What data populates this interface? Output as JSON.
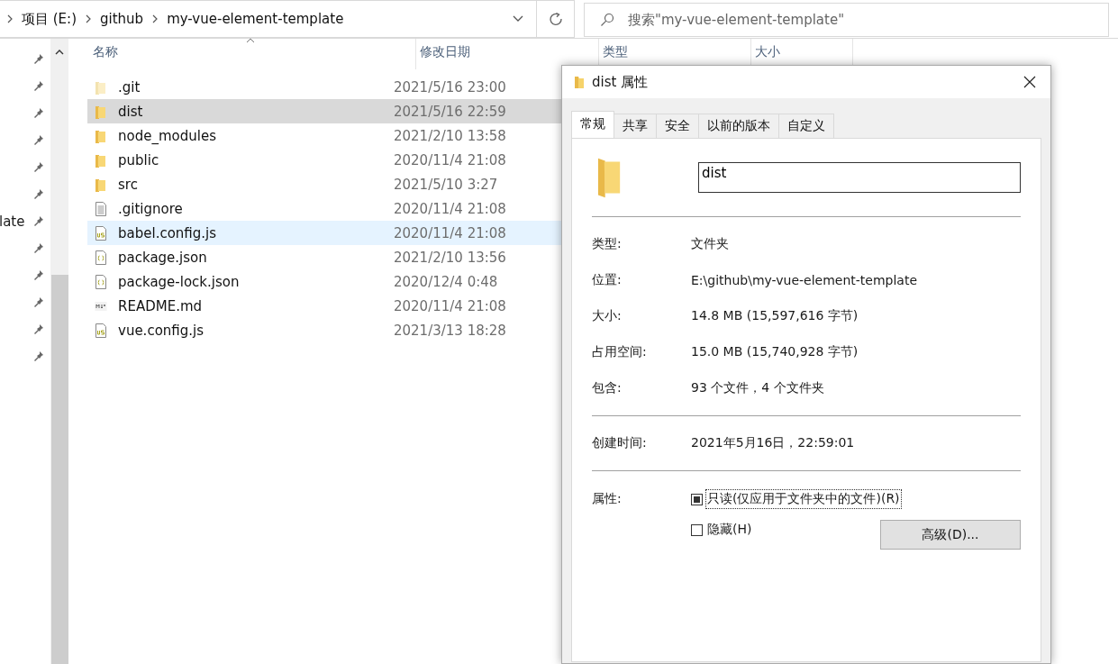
{
  "address_bar": {
    "breadcrumbs": [
      "项目 (E:)",
      "github",
      "my-vue-element-template"
    ]
  },
  "search": {
    "placeholder": "搜索\"my-vue-element-template\""
  },
  "nav_pane": {
    "visible_label": "late"
  },
  "file_list": {
    "columns": [
      "名称",
      "修改日期",
      "类型",
      "大小"
    ],
    "rows": [
      {
        "name": ".git",
        "date": "2021/5/16 23:00",
        "kind": "hidden-folder",
        "selected": false,
        "hovered": false
      },
      {
        "name": "dist",
        "date": "2021/5/16 22:59",
        "kind": "folder",
        "selected": true,
        "hovered": false
      },
      {
        "name": "node_modules",
        "date": "2021/2/10 13:58",
        "kind": "folder",
        "selected": false,
        "hovered": false
      },
      {
        "name": "public",
        "date": "2020/11/4 21:08",
        "kind": "folder",
        "selected": false,
        "hovered": false
      },
      {
        "name": "src",
        "date": "2021/5/10 3:27",
        "kind": "folder",
        "selected": false,
        "hovered": false
      },
      {
        "name": ".gitignore",
        "date": "2020/11/4 21:08",
        "kind": "text",
        "selected": false,
        "hovered": false
      },
      {
        "name": "babel.config.js",
        "date": "2020/11/4 21:08",
        "kind": "js",
        "selected": false,
        "hovered": true
      },
      {
        "name": "package.json",
        "date": "2021/2/10 13:56",
        "kind": "json",
        "selected": false,
        "hovered": false
      },
      {
        "name": "package-lock.json",
        "date": "2020/12/4 0:48",
        "kind": "json",
        "selected": false,
        "hovered": false
      },
      {
        "name": "README.md",
        "date": "2020/11/4 21:08",
        "kind": "md",
        "selected": false,
        "hovered": false
      },
      {
        "name": "vue.config.js",
        "date": "2021/3/13 18:28",
        "kind": "js",
        "selected": false,
        "hovered": false
      }
    ]
  },
  "dialog": {
    "title": "dist 属性",
    "tabs": [
      {
        "label": "常规",
        "selected": true
      },
      {
        "label": "共享",
        "selected": false
      },
      {
        "label": "安全",
        "selected": false
      },
      {
        "label": "以前的版本",
        "selected": false
      },
      {
        "label": "自定义",
        "selected": false
      }
    ],
    "name_value": "dist",
    "groups": [
      [
        {
          "label": "类型:",
          "value": "文件夹"
        },
        {
          "label": "位置:",
          "value": "E:\\github\\my-vue-element-template"
        },
        {
          "label": "大小:",
          "value": "14.8 MB (15,597,616 字节)"
        },
        {
          "label": "占用空间:",
          "value": "15.0 MB (15,740,928 字节)"
        },
        {
          "label": "包含:",
          "value": "93 个文件，4 个文件夹"
        }
      ],
      [
        {
          "label": "创建时间:",
          "value": "2021年5月16日，22:59:01"
        }
      ]
    ],
    "attributes_label": "属性:",
    "checkboxes": [
      {
        "label": "只读(仅应用于文件夹中的文件)(R)",
        "checked": false,
        "indeterminate": true,
        "focused": true
      },
      {
        "label": "隐藏(H)",
        "checked": false,
        "indeterminate": false,
        "focused": false
      }
    ],
    "advanced_button": "高级(D)..."
  }
}
